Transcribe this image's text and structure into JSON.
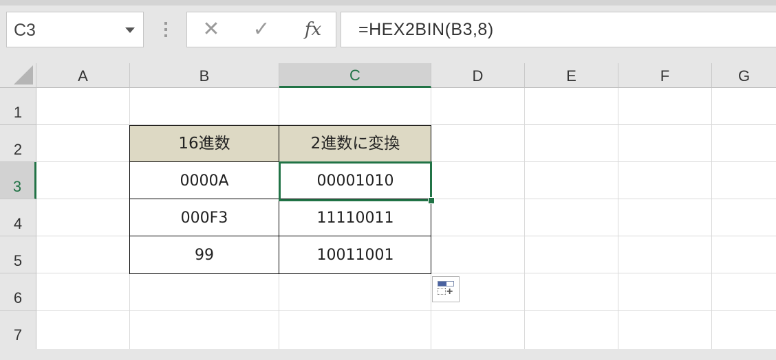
{
  "formula_bar": {
    "name_box": "C3",
    "cancel_icon": "✕",
    "enter_icon": "✓",
    "function_icon": "fx",
    "formula": "=HEX2BIN(B3,8)"
  },
  "columns": [
    "A",
    "B",
    "C",
    "D",
    "E",
    "F",
    "G"
  ],
  "active_column": "C",
  "rows": [
    "1",
    "2",
    "3",
    "4",
    "5",
    "6",
    "7"
  ],
  "active_row": "3",
  "table": {
    "headers": [
      "16進数",
      "2進数に変換"
    ],
    "rows": [
      [
        "0000A",
        "00001010"
      ],
      [
        "000F3",
        "11110011"
      ],
      [
        "99",
        "10011001"
      ]
    ]
  },
  "colors": {
    "accent": "#217346",
    "table_header_fill": "#ddd9c4"
  }
}
